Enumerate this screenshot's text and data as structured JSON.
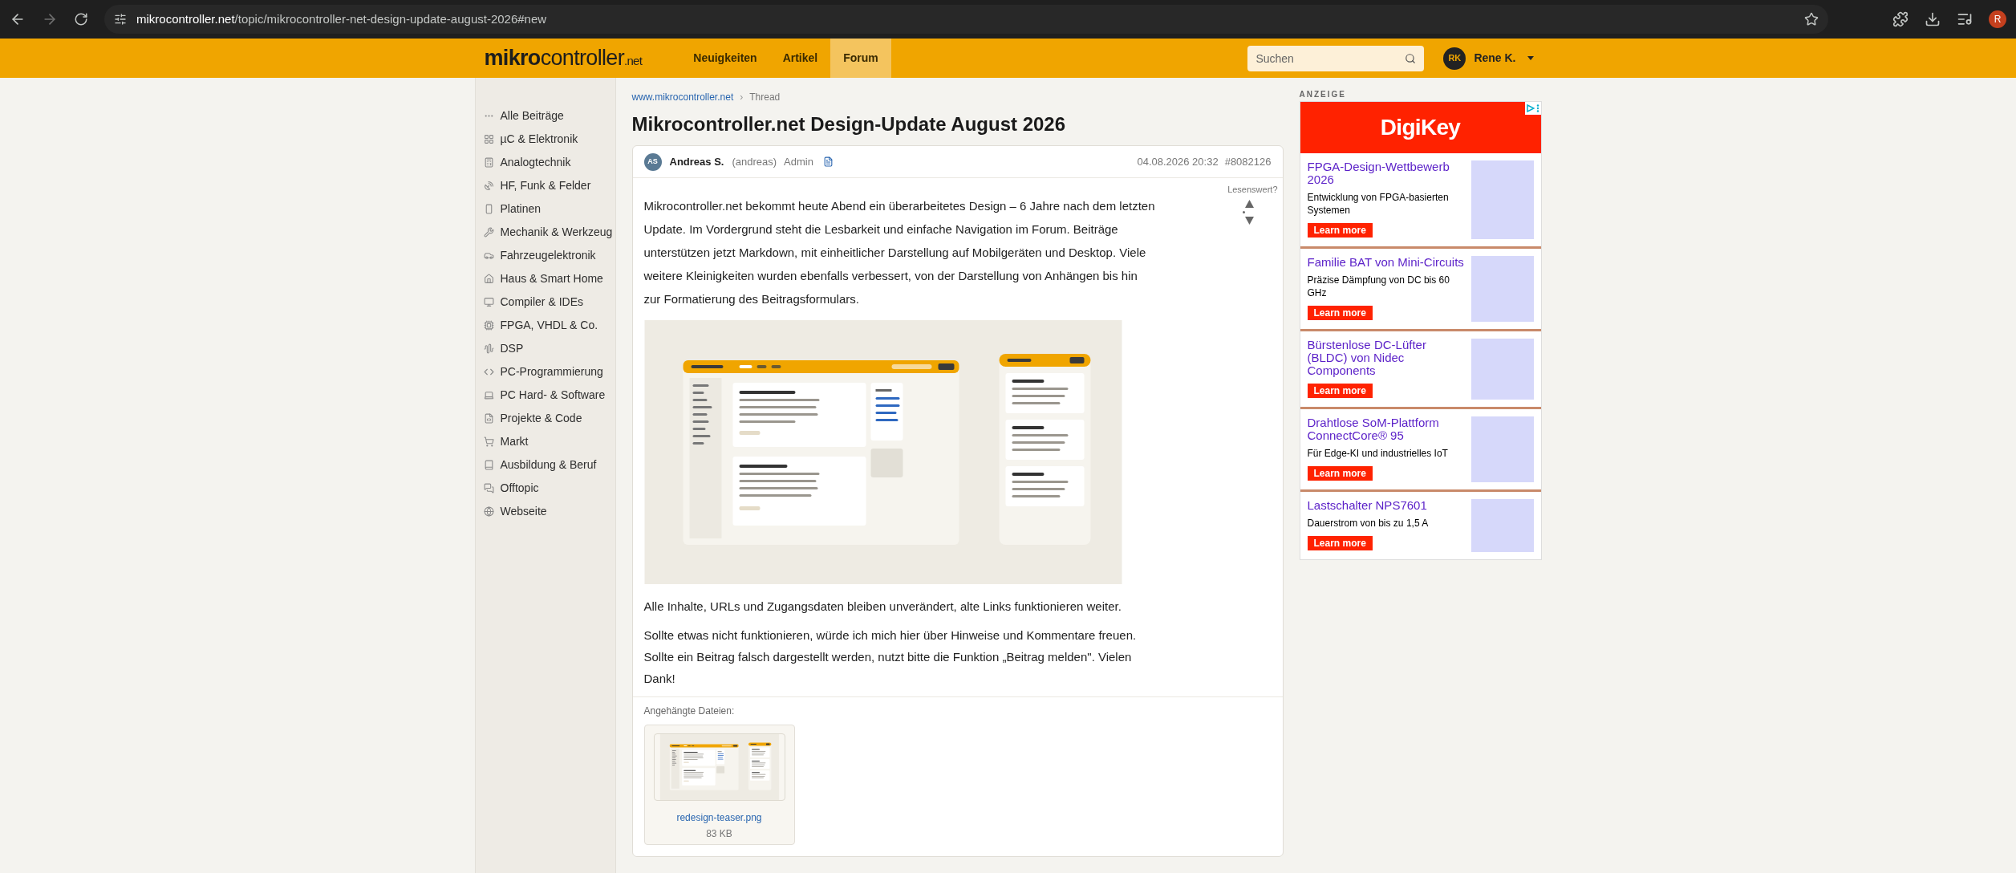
{
  "browser": {
    "url_host": "mikrocontroller.net",
    "url_path": "/topic/mikrocontroller-net-design-update-august-2026#new",
    "profile_initial": "R"
  },
  "header": {
    "logo": {
      "bold": "mikro",
      "light": "controller",
      "suffix": ".net"
    },
    "nav": [
      {
        "label": "Neuigkeiten",
        "selected": false
      },
      {
        "label": "Artikel",
        "selected": false
      },
      {
        "label": "Forum",
        "selected": true
      }
    ],
    "search": {
      "placeholder": "Suchen"
    },
    "user": {
      "initials": "RK",
      "name": "Rene K."
    }
  },
  "sidebar": {
    "items": [
      {
        "label": "Alle Beiträge"
      },
      {
        "label": "µC & Elektronik"
      },
      {
        "label": "Analogtechnik"
      },
      {
        "label": "HF, Funk & Felder"
      },
      {
        "label": "Platinen"
      },
      {
        "label": "Mechanik & Werkzeug"
      },
      {
        "label": "Fahrzeugelektronik"
      },
      {
        "label": "Haus & Smart Home"
      },
      {
        "label": "Compiler & IDEs"
      },
      {
        "label": "FPGA, VHDL & Co."
      },
      {
        "label": "DSP"
      },
      {
        "label": "PC-Programmierung"
      },
      {
        "label": "PC Hard- & Software"
      },
      {
        "label": "Projekte & Code"
      },
      {
        "label": "Markt"
      },
      {
        "label": "Ausbildung & Beruf"
      },
      {
        "label": "Offtopic"
      },
      {
        "label": "Webseite"
      }
    ]
  },
  "breadcrumb_separator": "›",
  "breadcrumb": [
    {
      "label": "www.mikrocontroller.net",
      "kind": "link"
    },
    {
      "label": "Thread",
      "kind": "current"
    }
  ],
  "thread_title": "Mikrocontroller.net Design-Update August 2026",
  "post": {
    "author": {
      "initials": "AS",
      "name": "Andreas S.",
      "username": "(andreas)",
      "role": "Admin"
    },
    "date": "04.08.2026 20:32",
    "number": "#8082126",
    "rating_label": "Lesenswert?",
    "paragraphs_before": [
      "Mikrocontroller.net bekommt heute Abend ein überarbeitetes Design – 6 Jahre nach dem letzten Update. Im Vordergrund steht die Lesbarkeit und einfache Navigation im Forum. Beiträge unterstützen jetzt Markdown, mit einheitlicher Darstellung auf Mobilgeräten und Desktop. Viele weitere Kleinigkeiten wurden ebenfalls verbessert, von der Darstellung von Anhängen bis hin zur Formatierung des Beitragsformulars."
    ],
    "paragraphs_after": [
      "Alle Inhalte, URLs und Zugangsdaten bleiben unverändert, alte Links funktionieren weiter.",
      "Sollte etwas nicht funktionieren, würde ich mich hier über Hinweise und Kommentare freuen. Sollte ein Beitrag falsch dargestellt werden, nutzt bitte die Funktion „Beitrag melden\". Vielen Dank!"
    ],
    "attachments_label": "Angehängte Dateien:",
    "attachments": [
      {
        "name": "redesign-teaser.png",
        "size": "83 KB"
      }
    ]
  },
  "ads": {
    "label": "ANZEIGE",
    "brand": "DigiKey",
    "items": [
      {
        "title": "FPGA-Design-Wettbewerb 2026",
        "description": "Entwicklung von FPGA-basierten Systemen",
        "button": "Learn more"
      },
      {
        "title": "Familie BAT von Mini-Circuits",
        "description": "Präzise Dämpfung von DC bis 60 GHz",
        "button": "Learn more"
      },
      {
        "title": "Bürstenlose DC-Lüfter (BLDC) von Nidec Components",
        "button": "Learn more"
      },
      {
        "title": "Drahtlose SoM-Plattform ConnectCore® 95",
        "description": "Für Edge-KI und industrielles IoT",
        "button": "Learn more"
      },
      {
        "title": "Lastschalter NPS7601",
        "description": "Dauerstrom von bis zu 1,5 A",
        "button": "Learn more"
      }
    ]
  }
}
